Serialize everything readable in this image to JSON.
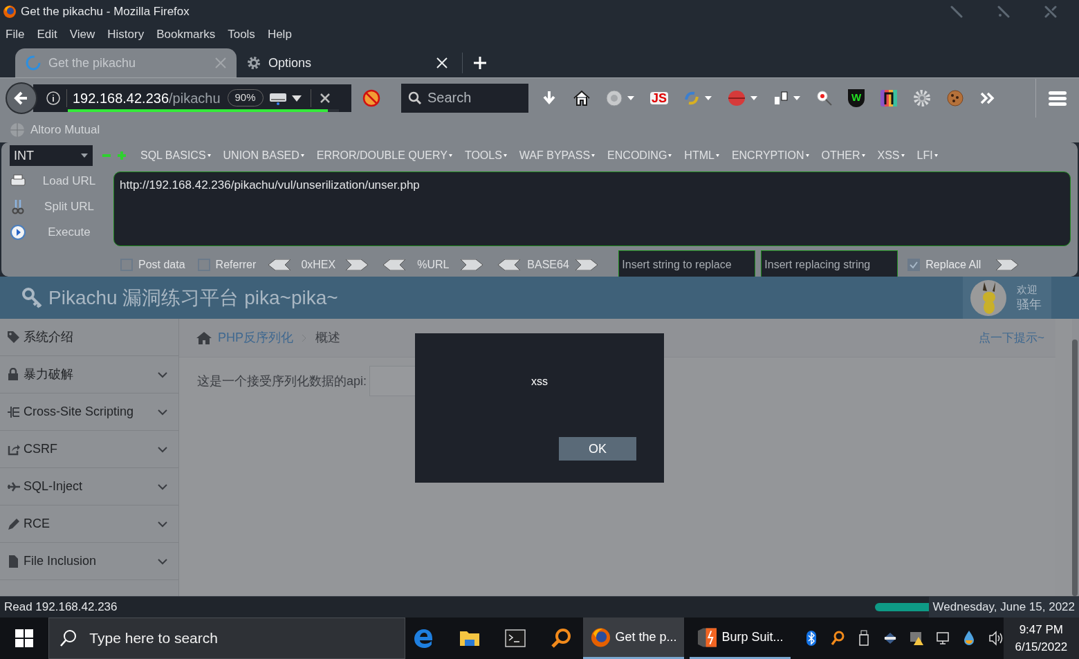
{
  "window": {
    "title": "Get the pikachu - Mozilla Firefox"
  },
  "menu": [
    "File",
    "Edit",
    "View",
    "History",
    "Bookmarks",
    "Tools",
    "Help"
  ],
  "tabs": [
    {
      "label": "Get the pikachu",
      "selected": true,
      "kind": "loading"
    },
    {
      "label": "Options",
      "selected": false,
      "kind": "settings"
    }
  ],
  "nav": {
    "url_host": "192.168.42.236",
    "url_path": "/pikachu",
    "zoom": "90%",
    "load_progress": {
      "level": 0.96
    },
    "search_placeholder": "Search"
  },
  "toolbar_icons": [
    {
      "kind": "download",
      "dropdown": false
    },
    {
      "kind": "home",
      "dropdown": false
    },
    {
      "kind": "globe",
      "dropdown": true
    },
    {
      "kind": "js",
      "label": "JS",
      "dropdown": false
    },
    {
      "kind": "swirl",
      "dropdown": true
    },
    {
      "kind": "ball",
      "dropdown": true
    },
    {
      "kind": "pages",
      "dropdown": true
    },
    {
      "kind": "magnifier",
      "dropdown": false
    },
    {
      "kind": "shield",
      "label": "W",
      "dropdown": false
    },
    {
      "kind": "rainbow",
      "dropdown": false
    },
    {
      "kind": "gear",
      "dropdown": false
    },
    {
      "kind": "cookie",
      "dropdown": false
    },
    {
      "kind": "chevrons",
      "dropdown": false
    }
  ],
  "bookmarks": [
    "Altoro Mutual"
  ],
  "hackbar": {
    "select": "INT",
    "menus": [
      "SQL BASICS",
      "UNION BASED",
      "ERROR/DOUBLE QUERY",
      "TOOLS",
      "WAF BYPASS",
      "ENCODING",
      "HTML",
      "ENCRYPTION",
      "OTHER",
      "XSS",
      "LFI"
    ],
    "actions": [
      {
        "label": "Load URL",
        "kind": "load"
      },
      {
        "label": "Split URL",
        "kind": "split"
      },
      {
        "label": "Execute",
        "kind": "execute"
      }
    ],
    "url": "http://192.168.42.236/pikachu/vul/unserilization/unser.php",
    "checkboxes": [
      {
        "label": "Post data",
        "checked": false
      },
      {
        "label": "Referrer",
        "checked": false
      }
    ],
    "encoders": [
      "0xHEX",
      "%URL",
      "BASE64"
    ],
    "replace_placeholder": "Insert string to replace",
    "replacing_placeholder": "Insert replacing string",
    "replace_all": {
      "label": "Replace All",
      "checked": true
    }
  },
  "page": {
    "title": "Pikachu 漏洞练习平台 pika~pika~",
    "welcome": [
      "欢迎",
      "骚年"
    ],
    "sidebar": [
      {
        "label": "系统介绍",
        "kind": "tag",
        "expandable": false
      },
      {
        "label": "暴力破解",
        "kind": "lock",
        "expandable": true
      },
      {
        "label": "Cross-Site Scripting",
        "kind": "xss",
        "expandable": true
      },
      {
        "label": "CSRF",
        "kind": "share",
        "expandable": true
      },
      {
        "label": "SQL-Inject",
        "kind": "plane",
        "expandable": true
      },
      {
        "label": "RCE",
        "kind": "pencil",
        "expandable": true
      },
      {
        "label": "File Inclusion",
        "kind": "file",
        "expandable": true
      }
    ],
    "breadcrumb": [
      "PHP反序列化",
      "概述"
    ],
    "hint": "点一下提示~",
    "api_label": "这是一个接受序列化数据的api:"
  },
  "dialog": {
    "message": "xss",
    "button": "OK"
  },
  "status_bar": {
    "text": "Read 192.168.42.236",
    "tooltip": "Wednesday, June 15, 2022"
  },
  "taskbar": {
    "search_placeholder": "Type here to search",
    "pinned": [
      {
        "kind": "edge"
      },
      {
        "kind": "folder"
      },
      {
        "kind": "terminal"
      },
      {
        "kind": "search"
      }
    ],
    "windows": [
      {
        "label": "Get the p...",
        "kind": "firefox",
        "selected": true
      },
      {
        "label": "Burp Suit...",
        "kind": "burp",
        "selected": false
      }
    ],
    "tray": [
      {
        "kind": "bluetooth"
      },
      {
        "kind": "key"
      },
      {
        "kind": "usb"
      },
      {
        "kind": "nexus"
      },
      {
        "kind": "vm"
      },
      {
        "kind": "network"
      },
      {
        "kind": "drop"
      },
      {
        "kind": "volume"
      }
    ],
    "time": "9:47 PM",
    "date": "6/15/2022"
  }
}
